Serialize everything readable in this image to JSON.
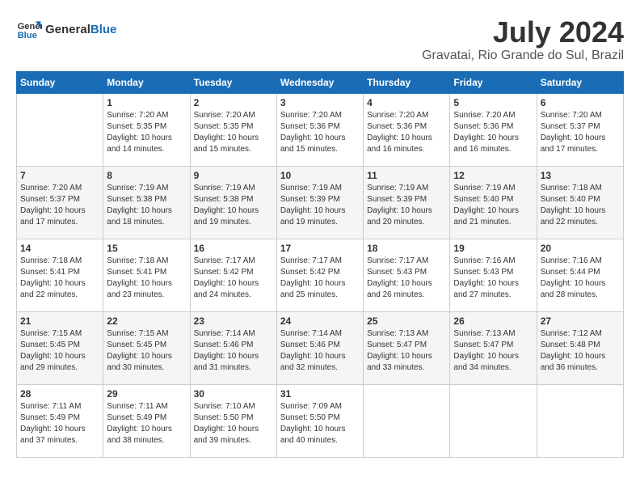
{
  "header": {
    "logo_line1": "General",
    "logo_line2": "Blue",
    "month": "July 2024",
    "location": "Gravatai, Rio Grande do Sul, Brazil"
  },
  "weekdays": [
    "Sunday",
    "Monday",
    "Tuesday",
    "Wednesday",
    "Thursday",
    "Friday",
    "Saturday"
  ],
  "weeks": [
    [
      {
        "day": "",
        "sunrise": "",
        "sunset": "",
        "daylight": ""
      },
      {
        "day": "1",
        "sunrise": "Sunrise: 7:20 AM",
        "sunset": "Sunset: 5:35 PM",
        "daylight": "Daylight: 10 hours and 14 minutes."
      },
      {
        "day": "2",
        "sunrise": "Sunrise: 7:20 AM",
        "sunset": "Sunset: 5:35 PM",
        "daylight": "Daylight: 10 hours and 15 minutes."
      },
      {
        "day": "3",
        "sunrise": "Sunrise: 7:20 AM",
        "sunset": "Sunset: 5:36 PM",
        "daylight": "Daylight: 10 hours and 15 minutes."
      },
      {
        "day": "4",
        "sunrise": "Sunrise: 7:20 AM",
        "sunset": "Sunset: 5:36 PM",
        "daylight": "Daylight: 10 hours and 16 minutes."
      },
      {
        "day": "5",
        "sunrise": "Sunrise: 7:20 AM",
        "sunset": "Sunset: 5:36 PM",
        "daylight": "Daylight: 10 hours and 16 minutes."
      },
      {
        "day": "6",
        "sunrise": "Sunrise: 7:20 AM",
        "sunset": "Sunset: 5:37 PM",
        "daylight": "Daylight: 10 hours and 17 minutes."
      }
    ],
    [
      {
        "day": "7",
        "sunrise": "Sunrise: 7:20 AM",
        "sunset": "Sunset: 5:37 PM",
        "daylight": "Daylight: 10 hours and 17 minutes."
      },
      {
        "day": "8",
        "sunrise": "Sunrise: 7:19 AM",
        "sunset": "Sunset: 5:38 PM",
        "daylight": "Daylight: 10 hours and 18 minutes."
      },
      {
        "day": "9",
        "sunrise": "Sunrise: 7:19 AM",
        "sunset": "Sunset: 5:38 PM",
        "daylight": "Daylight: 10 hours and 19 minutes."
      },
      {
        "day": "10",
        "sunrise": "Sunrise: 7:19 AM",
        "sunset": "Sunset: 5:39 PM",
        "daylight": "Daylight: 10 hours and 19 minutes."
      },
      {
        "day": "11",
        "sunrise": "Sunrise: 7:19 AM",
        "sunset": "Sunset: 5:39 PM",
        "daylight": "Daylight: 10 hours and 20 minutes."
      },
      {
        "day": "12",
        "sunrise": "Sunrise: 7:19 AM",
        "sunset": "Sunset: 5:40 PM",
        "daylight": "Daylight: 10 hours and 21 minutes."
      },
      {
        "day": "13",
        "sunrise": "Sunrise: 7:18 AM",
        "sunset": "Sunset: 5:40 PM",
        "daylight": "Daylight: 10 hours and 22 minutes."
      }
    ],
    [
      {
        "day": "14",
        "sunrise": "Sunrise: 7:18 AM",
        "sunset": "Sunset: 5:41 PM",
        "daylight": "Daylight: 10 hours and 22 minutes."
      },
      {
        "day": "15",
        "sunrise": "Sunrise: 7:18 AM",
        "sunset": "Sunset: 5:41 PM",
        "daylight": "Daylight: 10 hours and 23 minutes."
      },
      {
        "day": "16",
        "sunrise": "Sunrise: 7:17 AM",
        "sunset": "Sunset: 5:42 PM",
        "daylight": "Daylight: 10 hours and 24 minutes."
      },
      {
        "day": "17",
        "sunrise": "Sunrise: 7:17 AM",
        "sunset": "Sunset: 5:42 PM",
        "daylight": "Daylight: 10 hours and 25 minutes."
      },
      {
        "day": "18",
        "sunrise": "Sunrise: 7:17 AM",
        "sunset": "Sunset: 5:43 PM",
        "daylight": "Daylight: 10 hours and 26 minutes."
      },
      {
        "day": "19",
        "sunrise": "Sunrise: 7:16 AM",
        "sunset": "Sunset: 5:43 PM",
        "daylight": "Daylight: 10 hours and 27 minutes."
      },
      {
        "day": "20",
        "sunrise": "Sunrise: 7:16 AM",
        "sunset": "Sunset: 5:44 PM",
        "daylight": "Daylight: 10 hours and 28 minutes."
      }
    ],
    [
      {
        "day": "21",
        "sunrise": "Sunrise: 7:15 AM",
        "sunset": "Sunset: 5:45 PM",
        "daylight": "Daylight: 10 hours and 29 minutes."
      },
      {
        "day": "22",
        "sunrise": "Sunrise: 7:15 AM",
        "sunset": "Sunset: 5:45 PM",
        "daylight": "Daylight: 10 hours and 30 minutes."
      },
      {
        "day": "23",
        "sunrise": "Sunrise: 7:14 AM",
        "sunset": "Sunset: 5:46 PM",
        "daylight": "Daylight: 10 hours and 31 minutes."
      },
      {
        "day": "24",
        "sunrise": "Sunrise: 7:14 AM",
        "sunset": "Sunset: 5:46 PM",
        "daylight": "Daylight: 10 hours and 32 minutes."
      },
      {
        "day": "25",
        "sunrise": "Sunrise: 7:13 AM",
        "sunset": "Sunset: 5:47 PM",
        "daylight": "Daylight: 10 hours and 33 minutes."
      },
      {
        "day": "26",
        "sunrise": "Sunrise: 7:13 AM",
        "sunset": "Sunset: 5:47 PM",
        "daylight": "Daylight: 10 hours and 34 minutes."
      },
      {
        "day": "27",
        "sunrise": "Sunrise: 7:12 AM",
        "sunset": "Sunset: 5:48 PM",
        "daylight": "Daylight: 10 hours and 36 minutes."
      }
    ],
    [
      {
        "day": "28",
        "sunrise": "Sunrise: 7:11 AM",
        "sunset": "Sunset: 5:49 PM",
        "daylight": "Daylight: 10 hours and 37 minutes."
      },
      {
        "day": "29",
        "sunrise": "Sunrise: 7:11 AM",
        "sunset": "Sunset: 5:49 PM",
        "daylight": "Daylight: 10 hours and 38 minutes."
      },
      {
        "day": "30",
        "sunrise": "Sunrise: 7:10 AM",
        "sunset": "Sunset: 5:50 PM",
        "daylight": "Daylight: 10 hours and 39 minutes."
      },
      {
        "day": "31",
        "sunrise": "Sunrise: 7:09 AM",
        "sunset": "Sunset: 5:50 PM",
        "daylight": "Daylight: 10 hours and 40 minutes."
      },
      {
        "day": "",
        "sunrise": "",
        "sunset": "",
        "daylight": ""
      },
      {
        "day": "",
        "sunrise": "",
        "sunset": "",
        "daylight": ""
      },
      {
        "day": "",
        "sunrise": "",
        "sunset": "",
        "daylight": ""
      }
    ]
  ]
}
